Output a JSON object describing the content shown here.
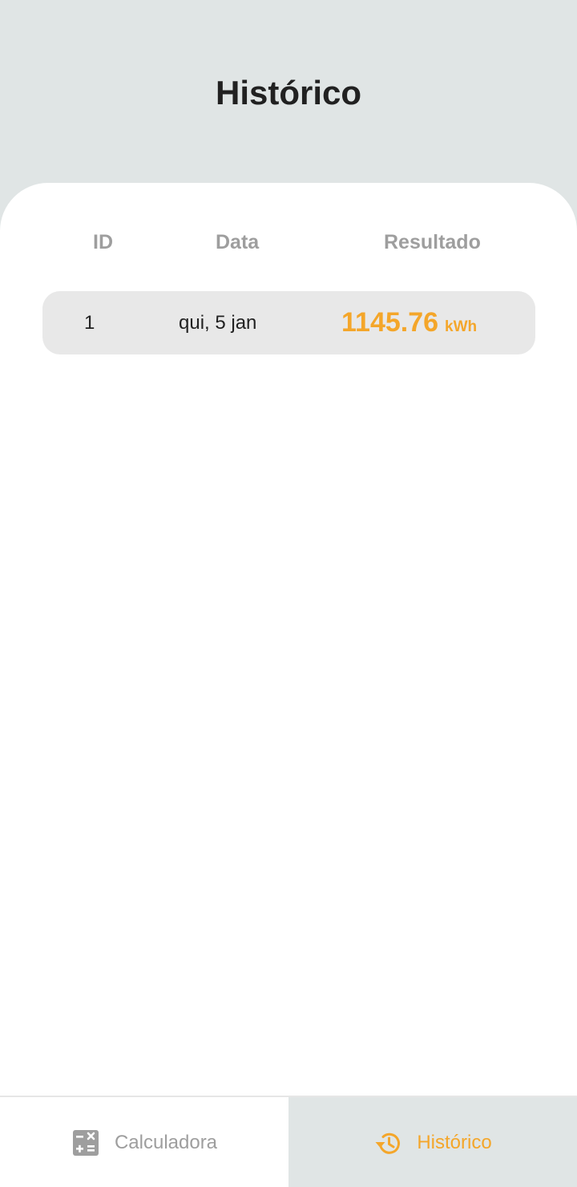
{
  "header": {
    "title": "Histórico"
  },
  "table": {
    "columns": {
      "id": "ID",
      "date": "Data",
      "result": "Resultado"
    },
    "rows": [
      {
        "id": "1",
        "date": "qui, 5 jan",
        "value": "1145.76",
        "unit": "kWh"
      }
    ]
  },
  "bottom_nav": {
    "tabs": [
      {
        "label": "Calculadora",
        "icon": "calculator-icon",
        "active": false
      },
      {
        "label": "Histórico",
        "icon": "history-icon",
        "active": true
      }
    ]
  },
  "colors": {
    "accent": "#f4a62a",
    "background": "#e0e5e5",
    "muted_text": "#9e9e9e",
    "row_background": "#e8e8e8"
  }
}
